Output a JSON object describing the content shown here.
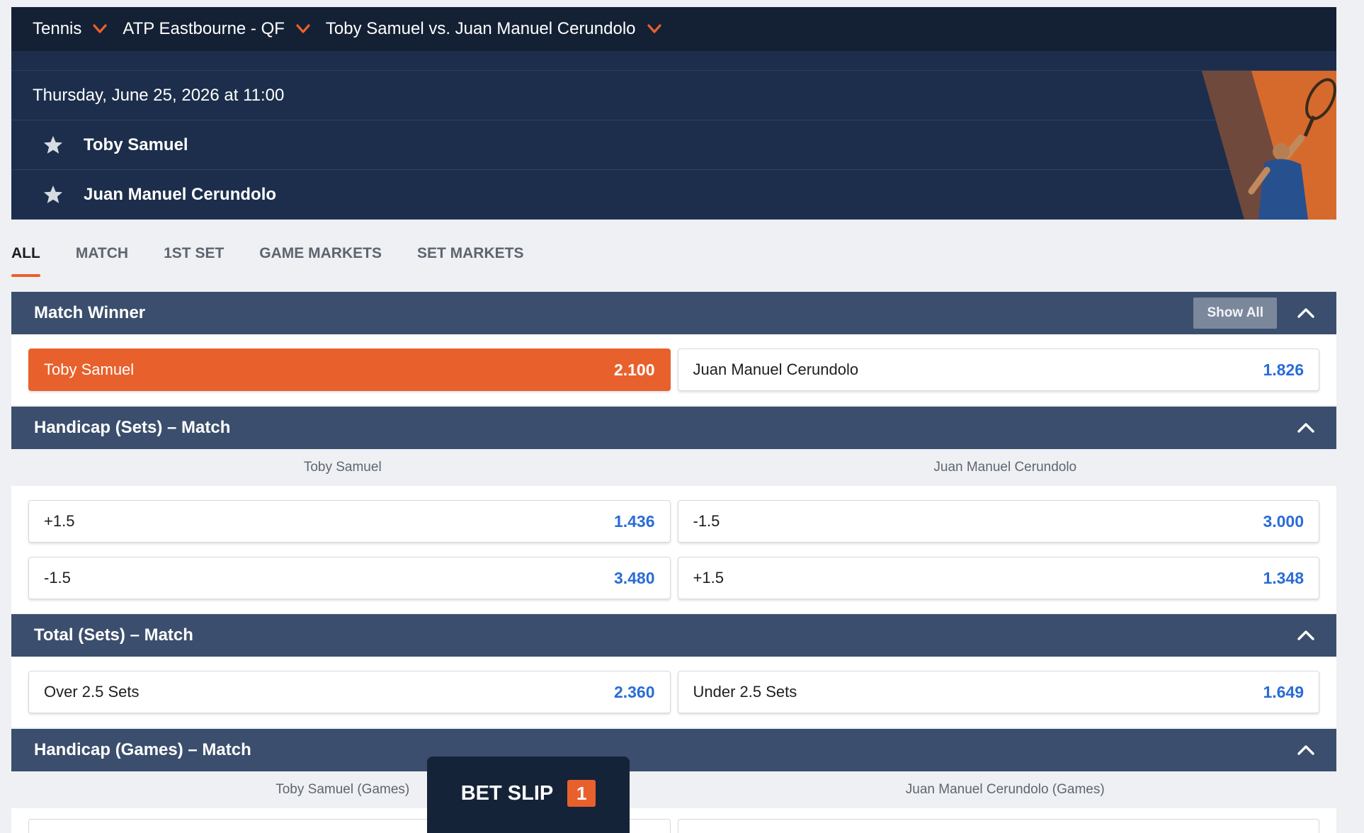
{
  "breadcrumb": [
    {
      "label": "Tennis"
    },
    {
      "label": "ATP Eastbourne - QF"
    },
    {
      "label": "Toby Samuel vs. Juan Manuel Cerundolo"
    }
  ],
  "event": {
    "datetime": "Thursday, June 25, 2026 at 11:00",
    "home": "Toby Samuel",
    "away": "Juan Manuel Cerundolo"
  },
  "tabs": [
    {
      "label": "ALL",
      "active": true
    },
    {
      "label": "MATCH"
    },
    {
      "label": "1ST SET"
    },
    {
      "label": "GAME MARKETS"
    },
    {
      "label": "SET MARKETS"
    }
  ],
  "markets": {
    "match_winner": {
      "title": "Match Winner",
      "show_all": "Show All",
      "options": [
        {
          "label": "Toby Samuel",
          "price": "2.100",
          "selected": true
        },
        {
          "label": "Juan Manuel Cerundolo",
          "price": "1.826"
        }
      ]
    },
    "handicap_sets": {
      "title": "Handicap (Sets) – Match",
      "col_left": "Toby Samuel",
      "col_right": "Juan Manuel Cerundolo",
      "rows": [
        [
          {
            "label": "+1.5",
            "price": "1.436"
          },
          {
            "label": "-1.5",
            "price": "3.000"
          }
        ],
        [
          {
            "label": "-1.5",
            "price": "3.480"
          },
          {
            "label": "+1.5",
            "price": "1.348"
          }
        ]
      ]
    },
    "total_sets": {
      "title": "Total (Sets) – Match",
      "options": [
        {
          "label": "Over 2.5 Sets",
          "price": "2.360"
        },
        {
          "label": "Under 2.5 Sets",
          "price": "1.649"
        }
      ]
    },
    "handicap_games": {
      "title": "Handicap (Games) – Match",
      "col_left": "Toby Samuel (Games)",
      "col_right": "Juan Manuel Cerundolo (Games)"
    }
  },
  "betslip": {
    "label": "BET SLIP",
    "count": "1"
  },
  "colors": {
    "accent": "#e8612c",
    "navy": "#142034",
    "market_header": "#3b4e6d",
    "price": "#2a6cd6"
  }
}
